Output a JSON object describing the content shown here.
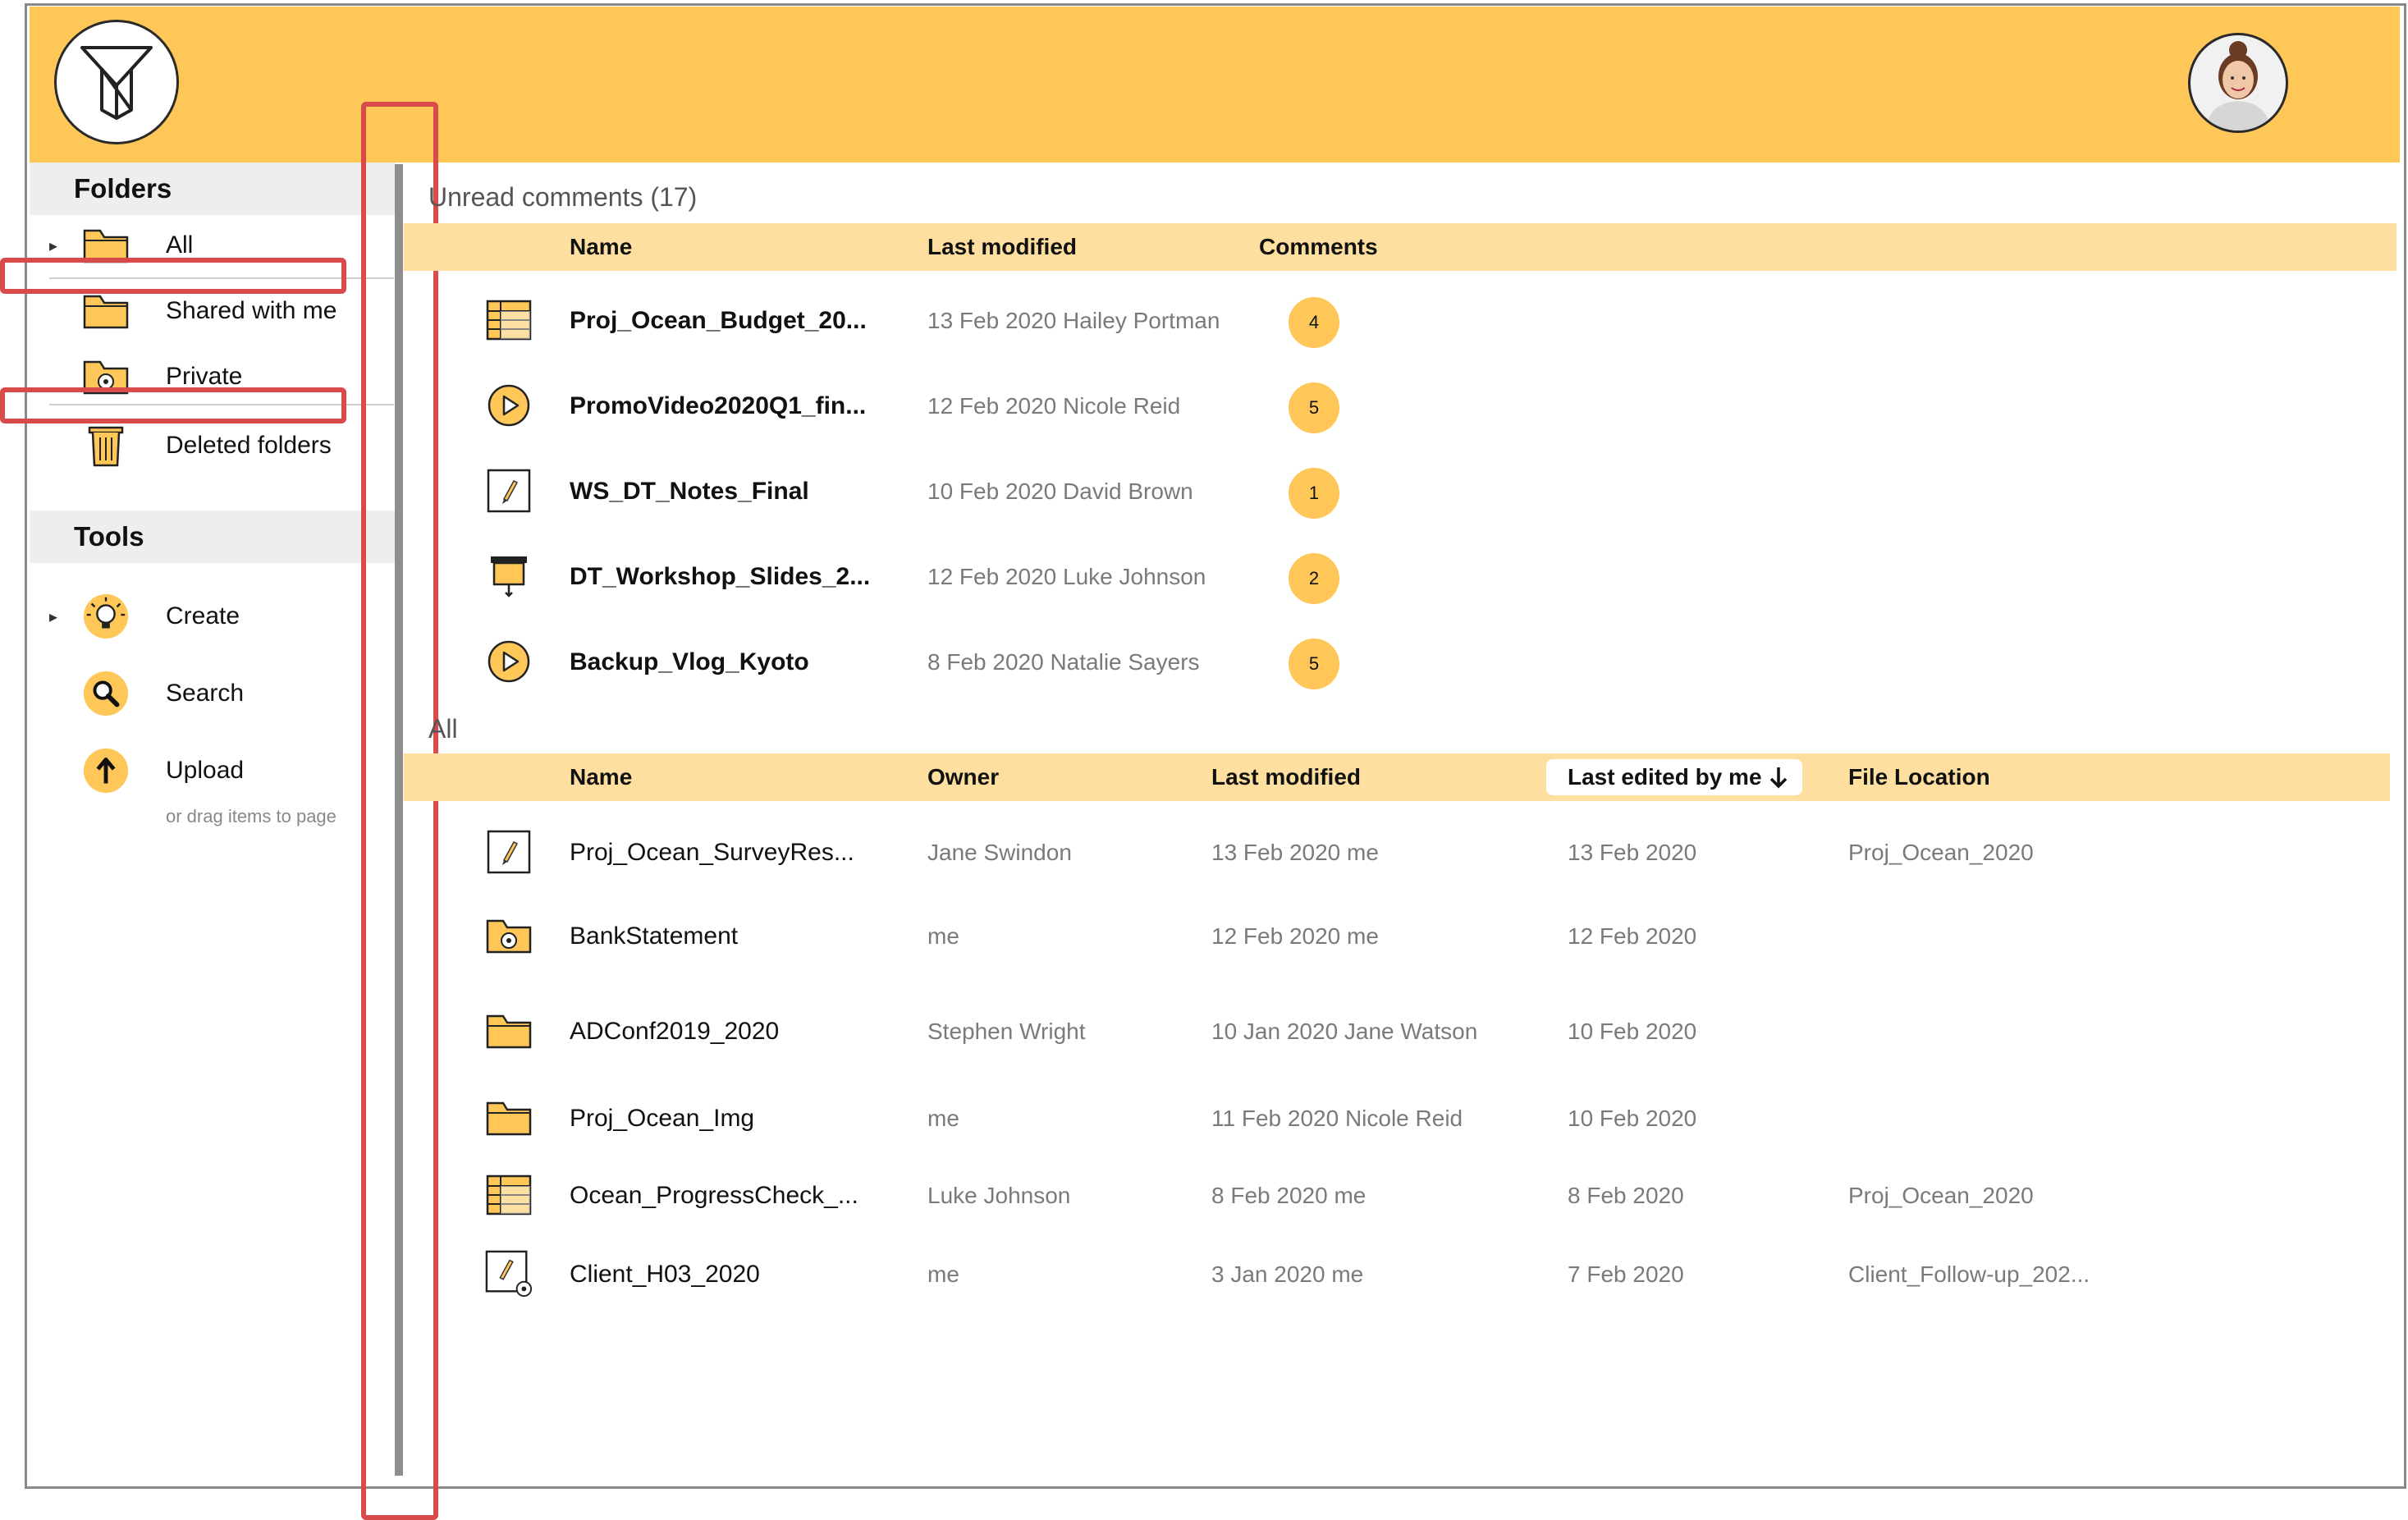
{
  "sidebar": {
    "folders_title": "Folders",
    "folders": [
      {
        "label": "All",
        "icon": "folder-icon"
      },
      {
        "label": "Shared with me",
        "icon": "folder-icon"
      },
      {
        "label": "Private",
        "icon": "private-folder-icon"
      },
      {
        "label": "Deleted folders",
        "icon": "trash-icon"
      }
    ],
    "tools_title": "Tools",
    "tools": [
      {
        "label": "Create",
        "icon": "lightbulb-icon"
      },
      {
        "label": "Search",
        "icon": "search-icon"
      },
      {
        "label": "Upload",
        "icon": "upload-icon"
      }
    ],
    "upload_hint": "or drag items to page"
  },
  "unread": {
    "title": "Unread comments (17)",
    "columns": {
      "name": "Name",
      "last_modified": "Last modified",
      "comments": "Comments"
    },
    "rows": [
      {
        "icon": "spreadsheet-icon",
        "name": "Proj_Ocean_Budget_20...",
        "modified": "13 Feb 2020 Hailey Portman",
        "comments": "4"
      },
      {
        "icon": "video-icon",
        "name": "PromoVideo2020Q1_fin...",
        "modified": "12 Feb 2020 Nicole Reid",
        "comments": "5"
      },
      {
        "icon": "document-icon",
        "name": "WS_DT_Notes_Final",
        "modified": "10 Feb 2020 David Brown",
        "comments": "1"
      },
      {
        "icon": "presentation-icon",
        "name": "DT_Workshop_Slides_2...",
        "modified": "12 Feb 2020 Luke Johnson",
        "comments": "2"
      },
      {
        "icon": "video-icon",
        "name": "Backup_Vlog_Kyoto",
        "modified": "8 Feb 2020 Natalie Sayers",
        "comments": "5"
      }
    ]
  },
  "all": {
    "title": "All",
    "columns": {
      "name": "Name",
      "owner": "Owner",
      "last_modified": "Last modified",
      "last_edited": "Last edited by me",
      "location": "File Location"
    },
    "rows": [
      {
        "icon": "document-icon",
        "name": "Proj_Ocean_SurveyRes...",
        "owner": "Jane Swindon",
        "modified": "13 Feb 2020 me",
        "edited": "13 Feb 2020",
        "location": "Proj_Ocean_2020"
      },
      {
        "icon": "private-folder-icon",
        "name": "BankStatement",
        "owner": "me",
        "modified": "12 Feb 2020 me",
        "edited": "12 Feb 2020",
        "location": ""
      },
      {
        "icon": "folder-icon",
        "name": "ADConf2019_2020",
        "owner": "Stephen Wright",
        "modified": "10 Jan 2020 Jane Watson",
        "edited": "10 Feb 2020",
        "location": ""
      },
      {
        "icon": "folder-icon",
        "name": "Proj_Ocean_Img",
        "owner": "me",
        "modified": "11 Feb 2020 Nicole Reid",
        "edited": "10 Feb 2020",
        "location": ""
      },
      {
        "icon": "spreadsheet-icon",
        "name": "Ocean_ProgressCheck_...",
        "owner": "Luke Johnson",
        "modified": "8 Feb 2020 me",
        "edited": "8 Feb 2020",
        "location": "Proj_Ocean_2020"
      },
      {
        "icon": "private-document-icon",
        "name": "Client_H03_2020",
        "owner": "me",
        "modified": "3 Jan 2020 me",
        "edited": "7 Feb 2020",
        "location": "Client_Follow-up_202..."
      }
    ]
  },
  "colors": {
    "accent": "#ffc658",
    "header_row": "#ffdf9f",
    "highlight": "#d94a4a"
  }
}
